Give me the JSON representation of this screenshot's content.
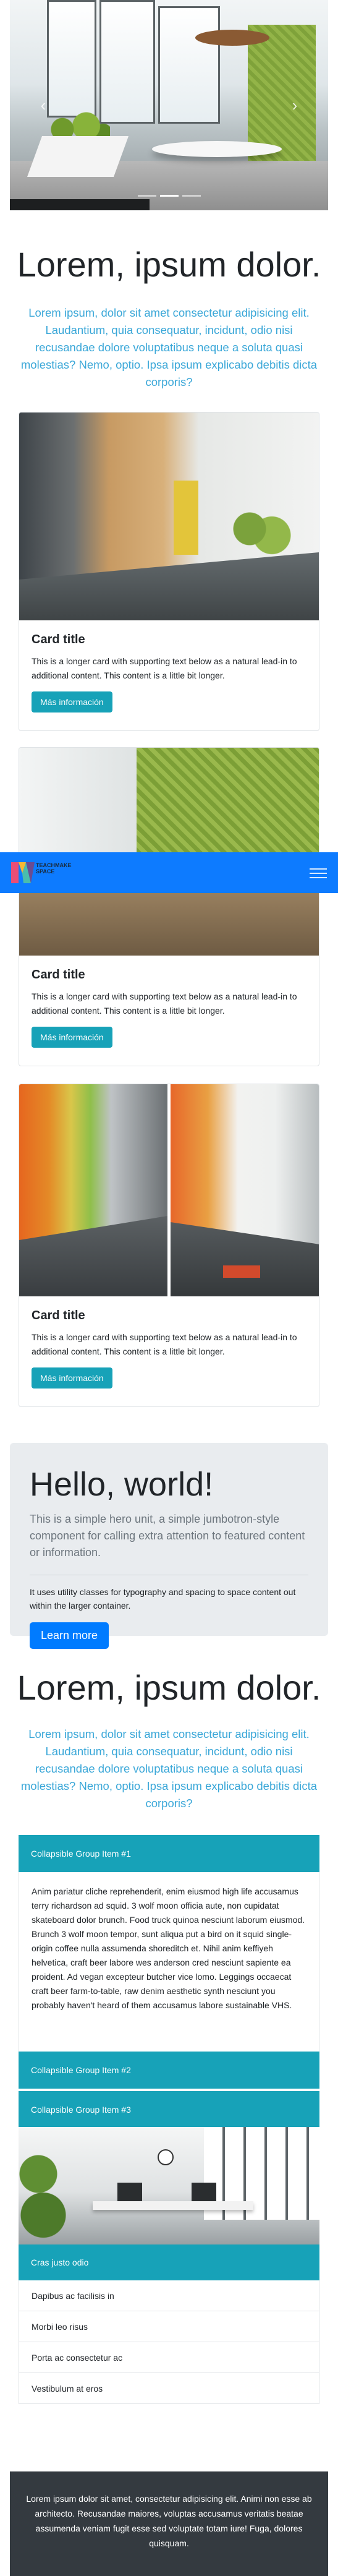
{
  "carousel": {
    "prev_icon": "chevron-left-icon",
    "next_icon": "chevron-right-icon",
    "indicator_count": 3,
    "active_indicator": 2
  },
  "section1": {
    "title": "Lorem, ipsum dolor.",
    "lead": "Lorem ipsum, dolor sit amet consectetur adipisicing elit. Laudantium, quia consequatur, incidunt, odio nisi recusandae dolore voluptatibus neque a soluta quasi molestias? Nemo, optio. Ipsa ipsum explicabo debitis dicta corporis?"
  },
  "cards": [
    {
      "title": "Card title",
      "text": "This is a longer card with supporting text below as a natural lead-in to additional content. This content is a little bit longer.",
      "button": "Más información"
    },
    {
      "title": "Card title",
      "text": "This is a longer card with supporting text below as a natural lead-in to additional content. This content is a little bit longer.",
      "button": "Más información"
    },
    {
      "title": "Card title",
      "text": "This is a longer card with supporting text below as a natural lead-in to additional content. This content is a little bit longer.",
      "button": "Más información"
    }
  ],
  "navbar": {
    "brand_text_1": "TEACHMAKE",
    "brand_text_2": "SPACE",
    "toggler_icon": "hamburger-menu-icon",
    "colors": {
      "background": "#0d7bff"
    }
  },
  "jumbotron": {
    "title": "Hello, world!",
    "lead": "This is a simple hero unit, a simple jumbotron-style component for calling extra attention to featured content or information.",
    "text": "It uses utility classes for typography and spacing to space content out within the larger container.",
    "button": "Learn more"
  },
  "section2": {
    "title": "Lorem, ipsum dolor.",
    "lead": "Lorem ipsum, dolor sit amet consectetur adipisicing elit. Laudantium, quia consequatur, incidunt, odio nisi recusandae dolore voluptatibus neque a soluta quasi molestias? Nemo, optio. Ipsa ipsum explicabo debitis dicta corporis?"
  },
  "accordion": {
    "item1": "Collapsible Group Item #1",
    "body1": "Anim pariatur cliche reprehenderit, enim eiusmod high life accusamus terry richardson ad squid. 3 wolf moon officia aute, non cupidatat skateboard dolor brunch. Food truck quinoa nesciunt laborum eiusmod. Brunch 3 wolf moon tempor, sunt aliqua put a bird on it squid single-origin coffee nulla assumenda shoreditch et. Nihil anim keffiyeh helvetica, craft beer labore wes anderson cred nesciunt sapiente ea proident. Ad vegan excepteur butcher vice lomo. Leggings occaecat craft beer farm-to-table, raw denim aesthetic synth nesciunt you probably haven't heard of them accusamus labore sustainable VHS.",
    "item2": "Collapsible Group Item #2",
    "item3": "Collapsible Group Item #3"
  },
  "list_group": {
    "header": "Cras justo odio",
    "items": [
      "Dapibus ac facilisis in",
      "Morbi leo risus",
      "Porta ac consectetur ac",
      "Vestibulum at eros"
    ]
  },
  "footer": {
    "text": "Lorem ipsum dolor sit amet, consectetur adipisicing elit. Animi non esse ab architecto. Recusandae maiores, voluptas accusamus veritatis beatae assumenda veniam fugit esse sed voluptate totam iure! Fuga, dolores quisquam."
  },
  "colors": {
    "info": "#17a2b8",
    "primary": "#007bff",
    "lead_blue": "#3aa7d8",
    "footer_bg": "#343a40",
    "jumbotron_bg": "#e9ecef"
  }
}
